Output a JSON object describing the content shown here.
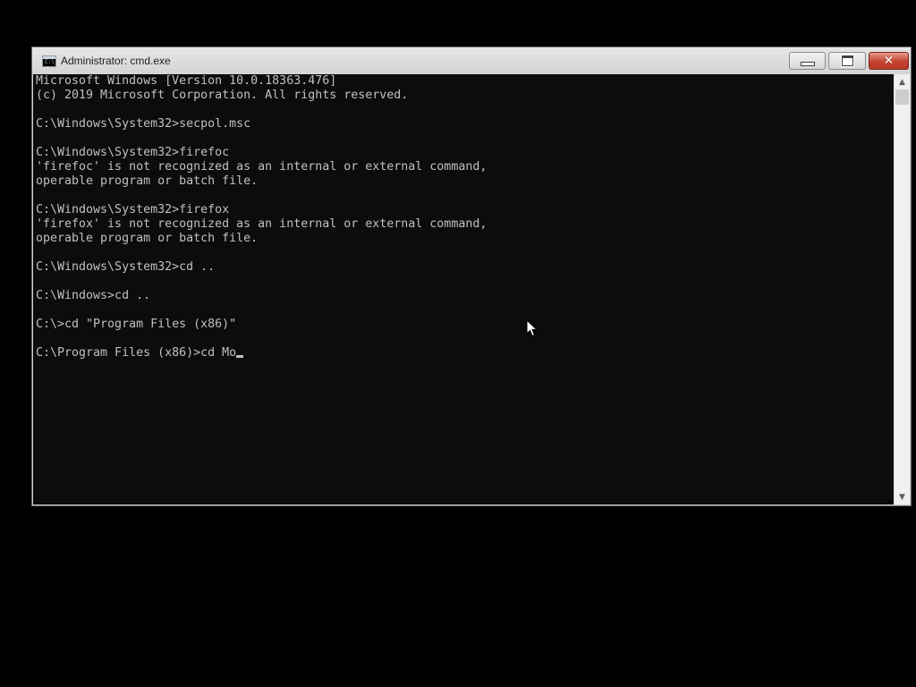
{
  "window": {
    "title": "Administrator: cmd.exe",
    "icon": "cmd-icon",
    "icon_glyph": "C:\\"
  },
  "controls": {
    "minimize_icon": "minimize-icon",
    "maximize_icon": "maximize-icon",
    "close_icon": "close-icon",
    "close_glyph": "✕"
  },
  "console": {
    "lines": [
      "Microsoft Windows [Version 10.0.18363.476]",
      "(c) 2019 Microsoft Corporation. All rights reserved.",
      "",
      "C:\\Windows\\System32>secpol.msc",
      "",
      "C:\\Windows\\System32>firefoc",
      "'firefoc' is not recognized as an internal or external command,",
      "operable program or batch file.",
      "",
      "C:\\Windows\\System32>firefox",
      "'firefox' is not recognized as an internal or external command,",
      "operable program or batch file.",
      "",
      "C:\\Windows\\System32>cd ..",
      "",
      "C:\\Windows>cd ..",
      "",
      "C:\\>cd \"Program Files (x86)\"",
      "",
      "C:\\Program Files (x86)>cd Mo"
    ]
  },
  "scrollbar": {
    "up_glyph": "▲",
    "down_glyph": "▼"
  },
  "colors": {
    "console_bg": "#0c0c0c",
    "console_fg": "#c0c0c0",
    "close_button": "#c4432f"
  }
}
